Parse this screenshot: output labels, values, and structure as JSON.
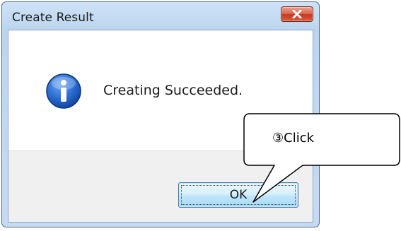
{
  "dialog": {
    "title": "Create Result",
    "close_icon": "close-x-icon",
    "message": "Creating Succeeded.",
    "message_icon": "info-icon",
    "ok_label": "OK"
  },
  "annotation": {
    "text": "③Click"
  },
  "colors": {
    "titlebar": "#c6dbf2",
    "close_button": "#c8381d",
    "info_icon": "#1b56b8",
    "ok_button": "#bee6fd"
  }
}
